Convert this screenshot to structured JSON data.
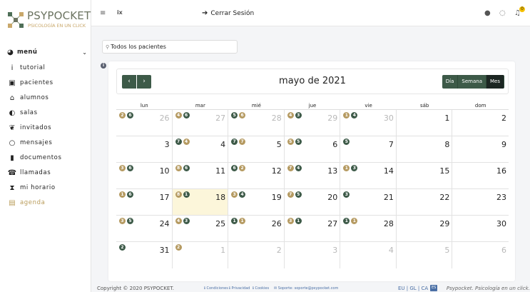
{
  "brand": {
    "name": "PSYPOCKET",
    "tagline": "PSICOLOGÍA EN UN CLICK"
  },
  "sidebar": {
    "menu_label": "menú",
    "items": [
      {
        "label": "tutorial",
        "icon": "info-icon"
      },
      {
        "label": "pacientes",
        "icon": "patients-icon"
      },
      {
        "label": "alumnos",
        "icon": "building-columns-icon"
      },
      {
        "label": "salas",
        "icon": "half-circle-icon"
      },
      {
        "label": "invitados",
        "icon": "guests-icon"
      },
      {
        "label": "mensajes",
        "icon": "chat-icon"
      },
      {
        "label": "documentos",
        "icon": "document-icon"
      },
      {
        "label": "llamadas",
        "icon": "calls-icon"
      },
      {
        "label": "mi horario",
        "icon": "hourglass-icon"
      },
      {
        "label": "agenda",
        "icon": "calendar-icon",
        "active": true
      }
    ]
  },
  "topbar": {
    "logout_label": "Cerrar Sesión",
    "notification_count": "0"
  },
  "search": {
    "value": "Todos los pacientes"
  },
  "calendar": {
    "title": "mayo de 2021",
    "views": [
      "Día",
      "Semana",
      "Mes"
    ],
    "active_view": "Mes",
    "weekdays": [
      "lun",
      "mar",
      "mié",
      "jue",
      "vie",
      "sáb",
      "dom"
    ],
    "weeks": [
      [
        {
          "day": "26",
          "other": true,
          "badges": [
            [
              "2",
              "gold"
            ],
            [
              "6",
              "green"
            ]
          ]
        },
        {
          "day": "27",
          "other": true,
          "badges": [
            [
              "4",
              "gold"
            ],
            [
              "6",
              "green"
            ]
          ]
        },
        {
          "day": "28",
          "other": true,
          "badges": [
            [
              "5",
              "green"
            ],
            [
              "6",
              "gold"
            ]
          ]
        },
        {
          "day": "29",
          "other": true,
          "badges": [
            [
              "4",
              "gold"
            ],
            [
              "3",
              "green"
            ]
          ]
        },
        {
          "day": "30",
          "other": true,
          "badges": [
            [
              "1",
              "gold"
            ],
            [
              "4",
              "green"
            ]
          ]
        },
        {
          "day": "1",
          "badges": []
        },
        {
          "day": "2",
          "badges": []
        }
      ],
      [
        {
          "day": "3",
          "badges": []
        },
        {
          "day": "4",
          "badges": [
            [
              "7",
              "green"
            ],
            [
              "4",
              "gold"
            ]
          ]
        },
        {
          "day": "5",
          "badges": [
            [
              "7",
              "green"
            ],
            [
              "7",
              "gold"
            ]
          ]
        },
        {
          "day": "6",
          "badges": [
            [
              "5",
              "gold"
            ],
            [
              "5",
              "green"
            ]
          ]
        },
        {
          "day": "7",
          "badges": [
            [
              "5",
              "green"
            ]
          ]
        },
        {
          "day": "8",
          "badges": []
        },
        {
          "day": "9",
          "badges": []
        }
      ],
      [
        {
          "day": "10",
          "badges": [
            [
              "3",
              "gold"
            ],
            [
              "6",
              "green"
            ]
          ]
        },
        {
          "day": "11",
          "badges": [
            [
              "8",
              "gold"
            ],
            [
              "6",
              "green"
            ]
          ]
        },
        {
          "day": "12",
          "badges": [
            [
              "6",
              "green"
            ],
            [
              "2",
              "gold"
            ]
          ]
        },
        {
          "day": "13",
          "badges": [
            [
              "7",
              "gold"
            ],
            [
              "4",
              "green"
            ]
          ]
        },
        {
          "day": "14",
          "badges": [
            [
              "1",
              "gold"
            ],
            [
              "3",
              "green"
            ]
          ]
        },
        {
          "day": "15",
          "badges": []
        },
        {
          "day": "16",
          "badges": []
        }
      ],
      [
        {
          "day": "17",
          "badges": [
            [
              "1",
              "gold"
            ],
            [
              "6",
              "green"
            ]
          ]
        },
        {
          "day": "18",
          "today": true,
          "badges": [
            [
              "8",
              "gold"
            ],
            [
              "1",
              "green"
            ]
          ]
        },
        {
          "day": "19",
          "badges": [
            [
              "3",
              "gold"
            ],
            [
              "4",
              "green"
            ]
          ]
        },
        {
          "day": "20",
          "badges": [
            [
              "7",
              "gold"
            ],
            [
              "5",
              "green"
            ]
          ]
        },
        {
          "day": "21",
          "badges": [
            [
              "3",
              "green"
            ]
          ]
        },
        {
          "day": "22",
          "badges": []
        },
        {
          "day": "23",
          "badges": []
        }
      ],
      [
        {
          "day": "24",
          "badges": [
            [
              "3",
              "gold"
            ],
            [
              "5",
              "green"
            ]
          ]
        },
        {
          "day": "25",
          "badges": [
            [
              "4",
              "gold"
            ],
            [
              "3",
              "green"
            ]
          ]
        },
        {
          "day": "26",
          "badges": [
            [
              "1",
              "green"
            ],
            [
              "1",
              "gold"
            ]
          ]
        },
        {
          "day": "27",
          "badges": [
            [
              "3",
              "gold"
            ],
            [
              "1",
              "green"
            ]
          ]
        },
        {
          "day": "28",
          "badges": [
            [
              "1",
              "green"
            ],
            [
              "1",
              "gold"
            ]
          ]
        },
        {
          "day": "29",
          "badges": []
        },
        {
          "day": "30",
          "badges": []
        }
      ],
      [
        {
          "day": "31",
          "badges": [
            [
              "2",
              "green"
            ]
          ]
        },
        {
          "day": "1",
          "other": true,
          "badges": [
            [
              "2",
              "gold"
            ]
          ]
        },
        {
          "day": "2",
          "other": true,
          "badges": []
        },
        {
          "day": "3",
          "other": true,
          "badges": []
        },
        {
          "day": "4",
          "other": true,
          "badges": []
        },
        {
          "day": "5",
          "other": true,
          "badges": []
        },
        {
          "day": "6",
          "other": true,
          "badges": []
        }
      ]
    ]
  },
  "footer": {
    "copyright": "Copyright © 2020 PSYPOCKET.",
    "links": [
      "Condiciones",
      "Privacidad",
      "Cookies",
      "Soporte: soporte@psypocket.com"
    ],
    "languages": "EU | GL | CA |",
    "current_lang": "ES",
    "tagline": "Psypocket. Psicología en un click."
  },
  "colors": {
    "primary": "#3d5a48",
    "accent": "#b59a61",
    "today": "#fcf6da",
    "link": "#4a6fa5"
  }
}
